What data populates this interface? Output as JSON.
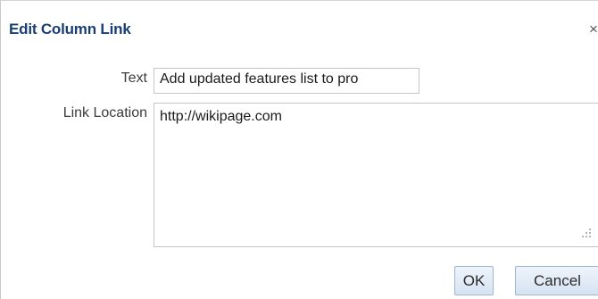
{
  "dialog": {
    "title": "Edit Column Link",
    "close_glyph": "×"
  },
  "form": {
    "text_label": "Text",
    "text_value": "Add updated features list to pro",
    "link_label": "Link Location",
    "link_value": "http://wikipage.com"
  },
  "buttons": {
    "ok_label": "OK",
    "cancel_label": "Cancel"
  },
  "icons": {
    "close": "close-icon",
    "resize": "resize-grip-icon"
  }
}
